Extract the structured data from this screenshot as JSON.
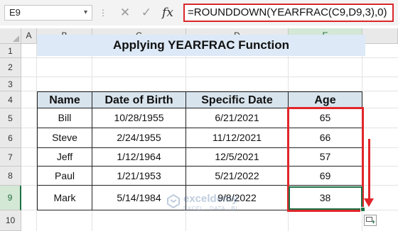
{
  "formula_bar": {
    "name_box": "E9",
    "formula": "=ROUNDDOWN(YEARFRAC(C9,D9,3),0)",
    "cancel_glyph": "✕",
    "enter_glyph": "✓",
    "fx_label": "fx"
  },
  "columns": [
    "A",
    "B",
    "C",
    "D",
    "E"
  ],
  "rows": [
    "1",
    "2",
    "3",
    "4",
    "5",
    "6",
    "7",
    "8",
    "9",
    "10"
  ],
  "selected": {
    "column": "E",
    "row": "9",
    "border_color": "#1e7145"
  },
  "sheet": {
    "title": "Applying YEARFRAC Function",
    "headers": [
      "Name",
      "Date of Birth",
      "Specific Date",
      "Age"
    ],
    "records": [
      [
        "Bill",
        "10/28/1955",
        "6/21/2021",
        "65"
      ],
      [
        "Steve",
        "2/24/1955",
        "11/12/2021",
        "66"
      ],
      [
        "Jeff",
        "1/12/1964",
        "12/5/2021",
        "57"
      ],
      [
        "Paul",
        "1/21/1953",
        "5/21/2022",
        "69"
      ],
      [
        "Mark",
        "5/14/1984",
        "9/8/2022",
        "38"
      ]
    ]
  },
  "watermark": {
    "title": "exceldemy",
    "subtitle": "EXCEL · DATA · BI"
  },
  "colors": {
    "highlight_red": "#e0262a",
    "title_band": "#dde9f6",
    "header_fill": "#d8e4ed",
    "excel_green": "#1e7145"
  }
}
